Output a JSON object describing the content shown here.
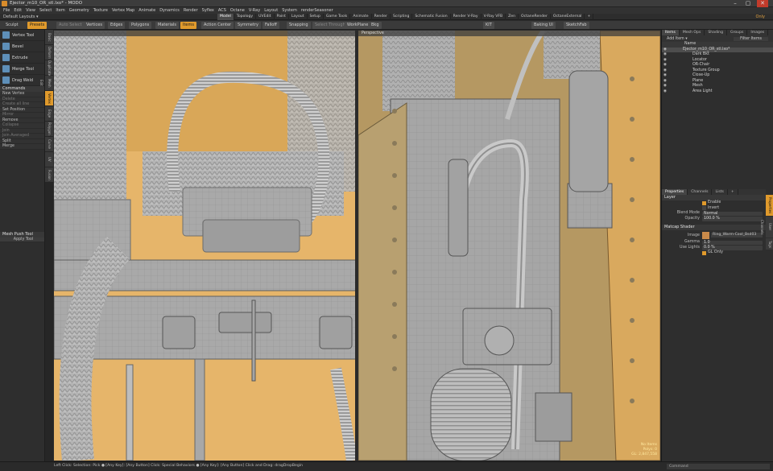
{
  "window": {
    "title": "Ejector_m10_OR_stl.lxo* - MODO",
    "min": "–",
    "max": "▢",
    "close": "✕"
  },
  "menu": [
    "File",
    "Edit",
    "View",
    "Select",
    "Item",
    "Geometry",
    "Texture",
    "Vertex Map",
    "Animate",
    "Dynamics",
    "Render",
    "Syflex",
    "ACS",
    "Octane",
    "V-Ray",
    "Layout",
    "System",
    "renderSeasoner"
  ],
  "layout": {
    "selector": "Default Layouts ▾",
    "tabs": [
      "Model",
      "Topology",
      "UVEdit",
      "Paint",
      "Layout",
      "Setup",
      "Game Tools",
      "Animate",
      "Render",
      "Scripting",
      "Schematic Fusion",
      "Render V-Ray",
      "V-Ray VFB",
      "Zen",
      "OctaneRender",
      "OctaneExternal",
      "+"
    ],
    "active_tab": "Model",
    "only": "Only"
  },
  "toolbar": {
    "sculpt": "Sculpt",
    "presets": "Presets",
    "auto_select": "Auto Select",
    "vertices": "Vertices",
    "edges": "Edges",
    "polygons": "Polygons",
    "materials": "Materials",
    "items": "Items",
    "action_center": "Action Center",
    "symmetry": "Symmetry",
    "falloff": "Falloff",
    "snapping": "Snapping",
    "select_through": "Select Through",
    "workplane": "WorkPlane",
    "bkg": "Bkg",
    "kit": "KIT",
    "baking_ui": "Baking UI",
    "sketchfab": "SketchFab"
  },
  "toolbox": {
    "tools": [
      {
        "label": "Vertex Tool"
      },
      {
        "label": "Bevel"
      },
      {
        "label": "Extrude"
      },
      {
        "label": "Merge Tool"
      },
      {
        "label": "Drag Weld"
      }
    ],
    "commands_head": "Commands",
    "commands": [
      {
        "label": "New Vertex",
        "dim": false
      },
      {
        "label": "Delete",
        "dim": true
      },
      {
        "label": "Create all line",
        "dim": true
      },
      {
        "label": "Set Position",
        "dim": false
      },
      {
        "label": "Mirror",
        "dim": true
      },
      {
        "label": "Remove",
        "dim": false
      },
      {
        "label": "Collapse",
        "dim": true
      },
      {
        "label": "Join",
        "dim": true
      },
      {
        "label": "Join Averaged",
        "dim": true
      },
      {
        "label": "Split",
        "dim": false
      },
      {
        "label": "Merge",
        "dim": false
      }
    ],
    "mesh_push_tool": "Mesh Push Tool",
    "apply_tool": "Apply Tool",
    "vtabs": [
      "Basic",
      "Deform",
      "Duplicate",
      "Mesh Edit",
      "Vertex",
      "Edge",
      "Polygon",
      "Curve",
      "UV",
      "Fusion"
    ]
  },
  "viewport_left": {
    "label": ""
  },
  "viewport_right": {
    "label": "Perspective",
    "info1": "No Items",
    "info2": "Polys: 0",
    "info3": "GL: 2,847,558"
  },
  "right_panel": {
    "top_tabs": [
      "Items",
      "Mesh Ops",
      "Shading",
      "Groups",
      "Images"
    ],
    "add_item": "Add Item ▾",
    "filter_items": "Filter Items",
    "name_col": "Name",
    "items": [
      {
        "name": "Ejector_m10_OR_stl.lxo*",
        "sel": true
      },
      {
        "name": "Dark Bkt",
        "sel": false
      },
      {
        "name": "Locator",
        "sel": false
      },
      {
        "name": "OR-Chair",
        "sel": false
      },
      {
        "name": "Texture Group",
        "sel": false
      },
      {
        "name": "Close-Up",
        "sel": false
      },
      {
        "name": "Plane",
        "sel": false
      },
      {
        "name": "Mesh",
        "sel": false
      },
      {
        "name": "Area Light",
        "sel": false
      }
    ],
    "prop_tabs": [
      "Properties",
      "Channels",
      "Lists",
      "+"
    ],
    "layer_head": "Layer",
    "enable": "Enable",
    "invert": "Invert",
    "blend_mode_label": "Blend Mode",
    "blend_mode": "Normal",
    "opacity_label": "Opacity",
    "opacity": "100.0 %",
    "matcap_head": "Matcap Shader",
    "image_label": "Image",
    "image": "Ring_Warm-Cool_Bsd03",
    "gamma_label": "Gamma",
    "gamma": "1.0",
    "use_lights_label": "Use Lights",
    "use_lights": "0.0 %",
    "gl_only": "GL Only",
    "side_tabs": [
      "Properties",
      "User Channels",
      "Tags"
    ]
  },
  "status": {
    "text": "Left Click: Selection: Pick ● [Any Key]: [Any Button] Click: Special Behaviors ● [Any Key]: [Any Button] Click and Drag: dragDropBegin",
    "command": "Command"
  },
  "colors": {
    "accent": "#e09a2c",
    "viewport_bg": "#e6b56a"
  }
}
